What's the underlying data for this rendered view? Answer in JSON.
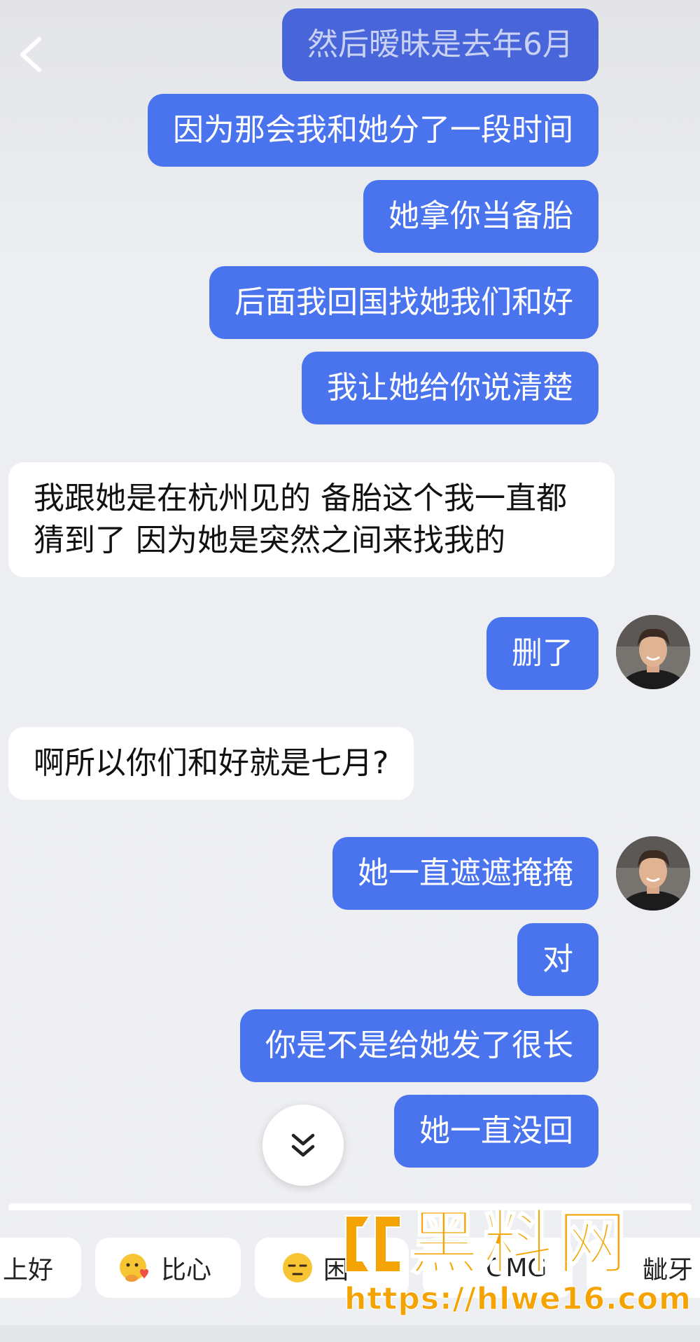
{
  "header": {
    "back_icon": "chevron-left-icon"
  },
  "messages": [
    {
      "side": "out",
      "text": "然后暧昧是去年6月"
    },
    {
      "side": "out",
      "text": "因为那会我和她分了一段时间"
    },
    {
      "side": "out",
      "text": "她拿你当备胎"
    },
    {
      "side": "out",
      "text": "后面我回国找她我们和好"
    },
    {
      "side": "out",
      "text": "我让她给你说清楚"
    },
    {
      "side": "in",
      "text": "我跟她是在杭州见的 备胎这个我一直都猜到了 因为她是突然之间来找我的"
    },
    {
      "side": "out",
      "text": "删了"
    },
    {
      "side": "in",
      "text": "啊所以你们和好就是七月?"
    },
    {
      "side": "out",
      "text": "她一直遮遮掩掩"
    },
    {
      "side": "out",
      "text": "对"
    },
    {
      "side": "out",
      "text": "你是不是给她发了很长"
    },
    {
      "side": "out",
      "text": "她一直没回"
    }
  ],
  "scroll_button": {
    "icon": "double-chevron-down-icon"
  },
  "quick_replies": [
    {
      "label": "上好",
      "icon": ""
    },
    {
      "label": "比心",
      "icon": "heart-hands-emoji-icon"
    },
    {
      "label": "困",
      "icon": "sleepy-emoji-icon"
    },
    {
      "label": "OMG",
      "icon": ""
    },
    {
      "label": "龇牙",
      "icon": ""
    }
  ],
  "watermark": {
    "title": "黑料网",
    "url": "https://hlwe16.com"
  },
  "colors": {
    "outgoing_bubble": "#4a73ee",
    "incoming_bubble": "#ffffff",
    "watermark": "#f5a300"
  }
}
